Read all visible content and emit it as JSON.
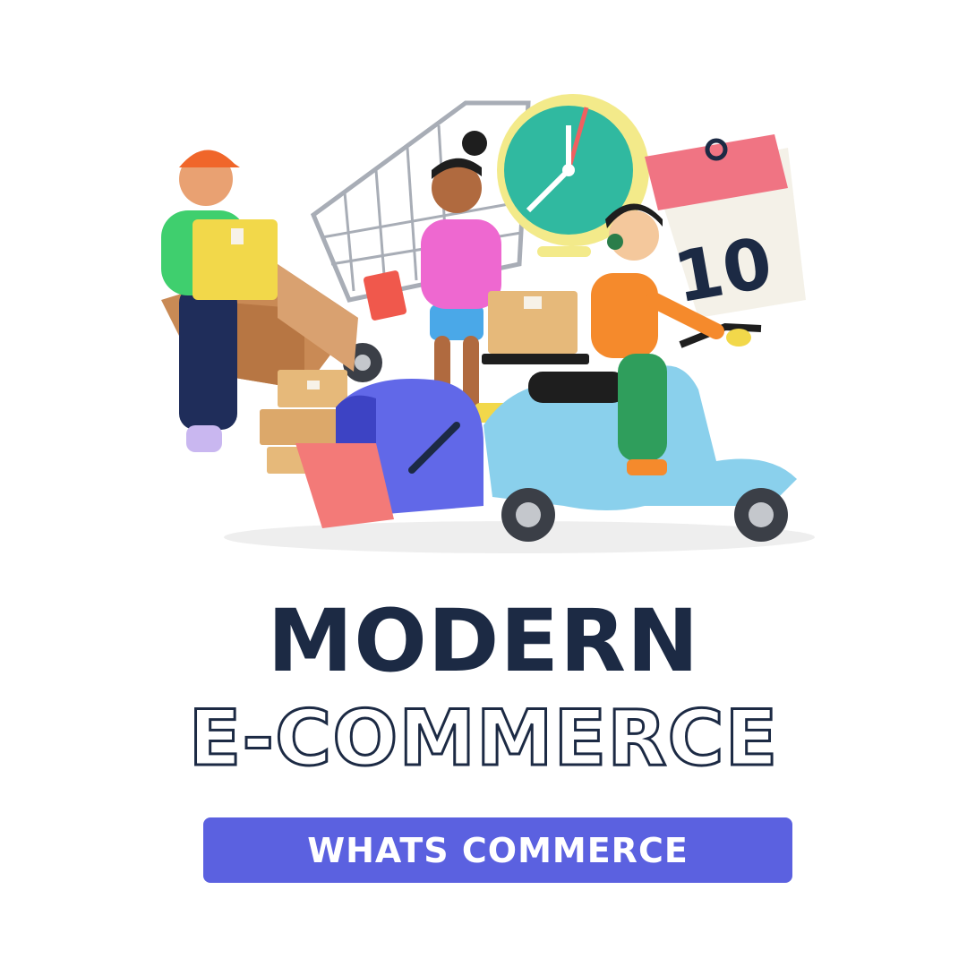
{
  "hero": {
    "calendar_day": "10"
  },
  "title": {
    "line1": "MODERN",
    "line2": "E-COMMERCE"
  },
  "badge": {
    "label": "WHATS COMMERCE"
  },
  "colors": {
    "title": "#1c2a44",
    "badge_bg": "#5b61e0",
    "badge_text": "#ffffff"
  }
}
